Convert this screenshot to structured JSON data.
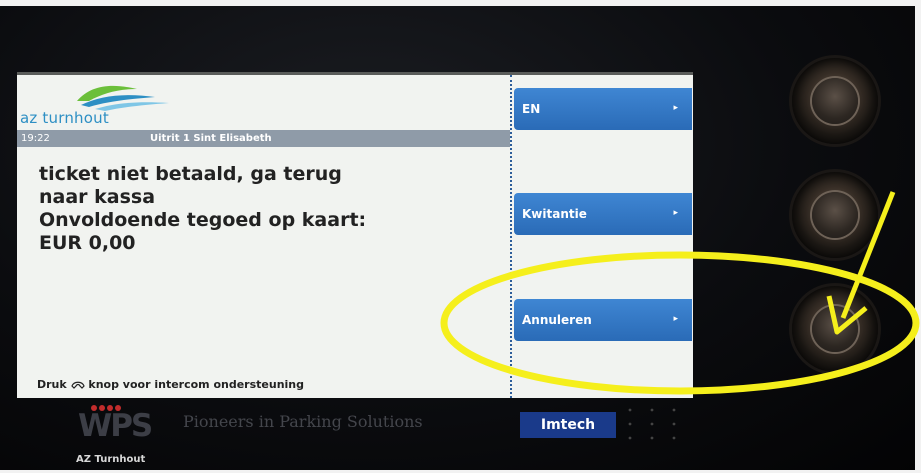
{
  "brand": {
    "name": "az turnhout"
  },
  "header": {
    "time": "19:22",
    "exit_name": "Uitrit 1 Sint Elisabeth"
  },
  "message": {
    "lines": [
      "ticket niet betaald, ga terug",
      "naar kassa",
      "Onvoldoende tegoed op kaart:",
      "EUR 0,00"
    ]
  },
  "buttons": [
    {
      "label": "EN",
      "arrow": "▸"
    },
    {
      "label": "Kwitantie",
      "arrow": "▸"
    },
    {
      "label": "Annuleren",
      "arrow": "▸"
    }
  ],
  "footer": {
    "hint_prefix": "Druk",
    "hint_suffix": "knop voor intercom ondersteuning"
  },
  "bezel": {
    "wps_logo": "WPS",
    "tagline": "Pioneers in Parking Solutions",
    "imtech": "Imtech",
    "location_label": "AZ Turnhout"
  },
  "colors": {
    "screen_bg": "#f1f3f0",
    "header_bar": "#8f9ba8",
    "button_blue": "#3f86d3",
    "annotation_yellow": "#f5ef1c",
    "logo_blue": "#2d8fc4",
    "logo_green": "#6bbf3a"
  },
  "icons": {
    "intercom": "phone-handset-icon",
    "annotation": "arrow-icon"
  }
}
